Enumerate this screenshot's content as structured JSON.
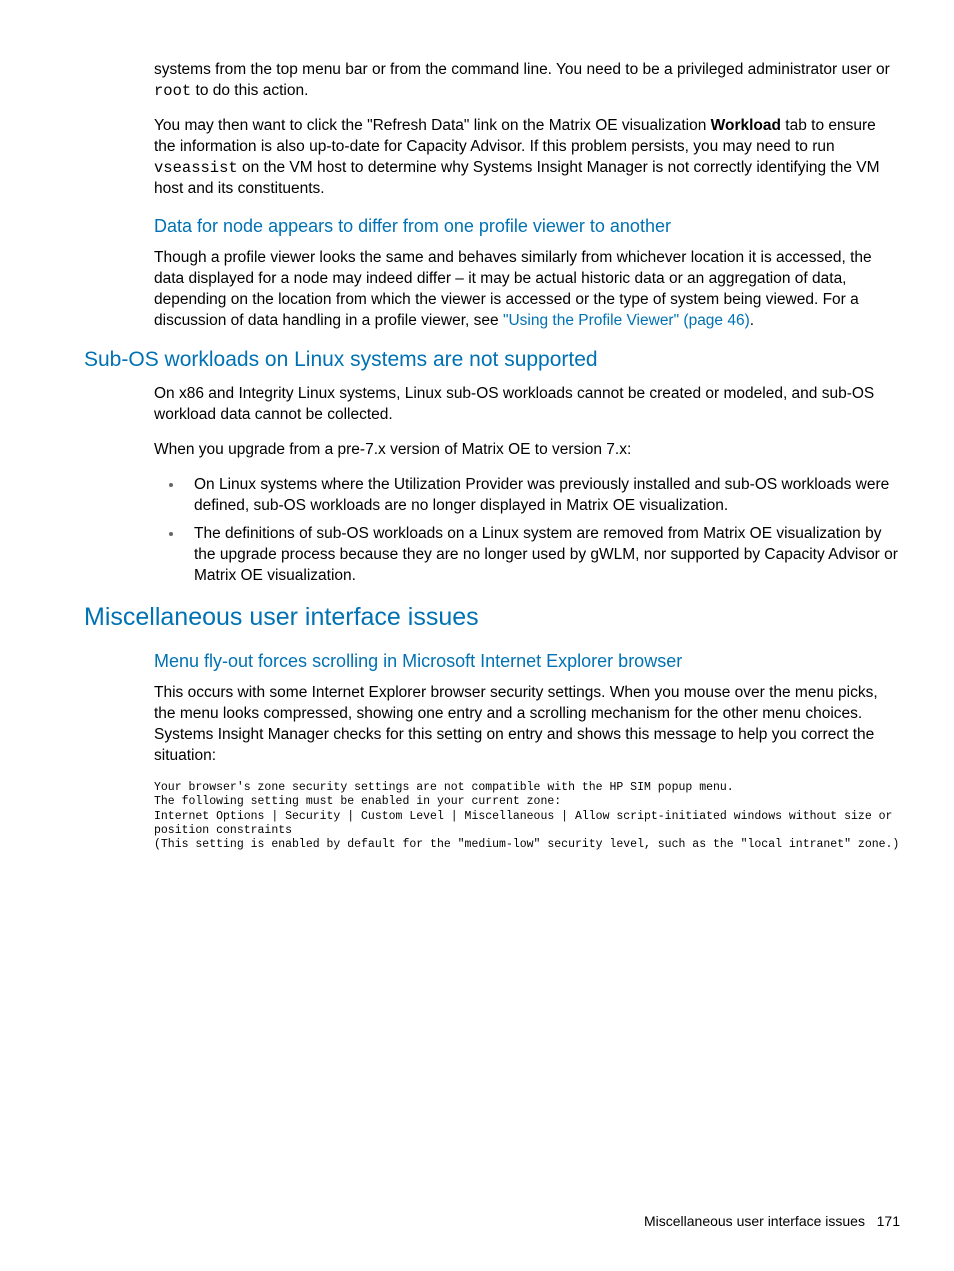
{
  "p1_part1": "systems from the top menu bar or from the command line. You need to be a privileged administrator user or ",
  "p1_code": "root",
  "p1_part2": " to do this action.",
  "p2_part1": "You may then want to click the \"Refresh Data\" link on the Matrix OE visualization ",
  "p2_bold": "Workload",
  "p2_part2": " tab to ensure the information is also up-to-date for Capacity Advisor. If this problem persists, you may need to run ",
  "p2_code": "vseassist",
  "p2_part3": " on the VM host to determine why Systems Insight Manager is not correctly identifying the VM host and its constituents.",
  "h3_1": "Data for node appears to differ from one profile viewer to another",
  "p3_part1": "Though a profile viewer looks the same and behaves similarly from whichever location it is accessed, the data displayed for a node may indeed differ – it may be actual historic data or an aggregation of data, depending on the location from which the viewer is accessed or the type of system being viewed. For a discussion of data handling in a profile viewer, see ",
  "p3_link": "\"Using the Profile Viewer\" (page 46)",
  "p3_part2": ".",
  "h2_1": "Sub-OS workloads on Linux systems are not supported",
  "p4": "On x86 and Integrity Linux systems, Linux sub-OS workloads cannot be created or modeled, and sub-OS workload data cannot be collected.",
  "p5": "When you upgrade from a pre-7.x version of Matrix OE to version 7.x:",
  "li1": "On Linux systems where the Utilization Provider was previously installed and sub-OS workloads were defined, sub-OS workloads are no longer displayed in Matrix OE visualization.",
  "li2": "The definitions of sub-OS workloads on a Linux system are removed from Matrix OE visualization by the upgrade process because they are no longer used by gWLM, nor supported by Capacity Advisor or Matrix OE visualization.",
  "h1_1": "Miscellaneous user interface issues",
  "h3_2": "Menu fly-out forces scrolling in Microsoft Internet Explorer browser",
  "p6": "This occurs with some Internet Explorer browser security settings. When you mouse over the menu picks, the menu looks compressed, showing one entry and a scrolling mechanism for the other menu choices. Systems Insight Manager checks for this setting on entry and shows this message to help you correct the situation:",
  "pre1": "Your browser's zone security settings are not compatible with the HP SIM popup menu.\nThe following setting must be enabled in your current zone:\nInternet Options | Security | Custom Level | Miscellaneous | Allow script-initiated windows without size or position constraints\n(This setting is enabled by default for the \"medium-low\" security level, such as the \"local intranet\" zone.)",
  "footer_text": "Miscellaneous user interface issues",
  "footer_page": "171"
}
